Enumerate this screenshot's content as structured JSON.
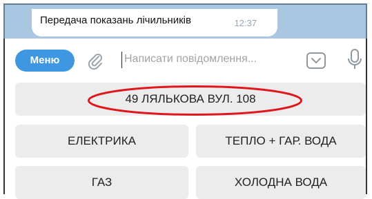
{
  "chat": {
    "message_text": "Передача показань лічильників",
    "message_time": "12:37"
  },
  "compose": {
    "menu_label": "Меню",
    "input_placeholder": "Написати повідомлення...",
    "icons": [
      "paperclip-icon",
      "keyboard-toggle-icon",
      "microphone-icon"
    ]
  },
  "keyboard": {
    "address_button": "49  ЛЯЛЬКОВА ВУЛ. 108",
    "buttons": [
      "ЕЛЕКТРИКА",
      "ТЕПЛО + ГАР. ВОДА",
      "ГАЗ",
      "ХОЛОДНА ВОДА"
    ]
  },
  "annotation": {
    "highlight_color": "#e0161b",
    "highlight_shape": "ellipse"
  },
  "colors": {
    "accent": "#3e97e0",
    "chat_background": "#a9c7e0",
    "key_background": "#ececec"
  }
}
